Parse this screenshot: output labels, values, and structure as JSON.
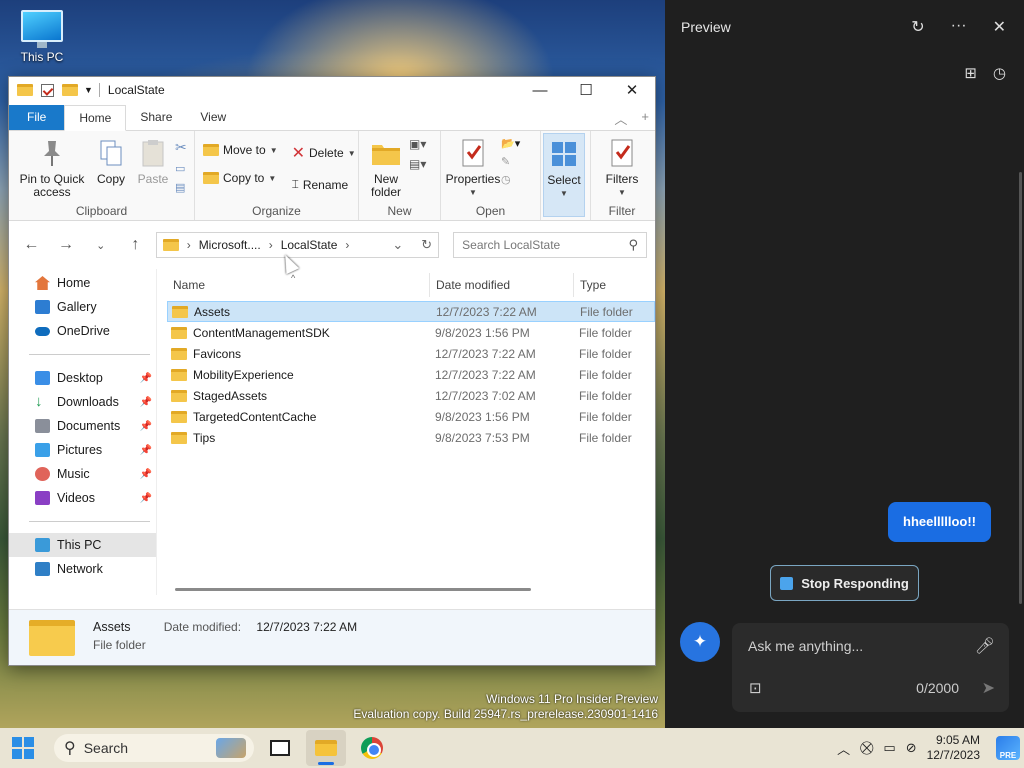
{
  "desktop": {
    "this_pc_label": "This PC",
    "watermark_line1": "Windows 11 Pro Insider Preview",
    "watermark_line2": "Evaluation copy. Build 25947.rs_prerelease.230901-1416"
  },
  "explorer": {
    "title": "LocalState",
    "tabs": {
      "file": "File",
      "home": "Home",
      "share": "Share",
      "view": "View"
    },
    "ribbon": {
      "clipboard": {
        "label": "Clipboard",
        "pin": "Pin to Quick access",
        "copy": "Copy",
        "paste": "Paste"
      },
      "organize": {
        "label": "Organize",
        "move_to": "Move to",
        "copy_to": "Copy to",
        "delete": "Delete",
        "rename": "Rename"
      },
      "new": {
        "label": "New",
        "new_folder": "New folder"
      },
      "open": {
        "label": "Open",
        "properties": "Properties"
      },
      "select": {
        "label": "Select"
      },
      "filter": {
        "label": "Filter",
        "filters": "Filters"
      }
    },
    "address": {
      "crumb1": "Microsoft....",
      "crumb2": "LocalState"
    },
    "search": {
      "placeholder": "Search LocalState"
    },
    "nav": {
      "home": "Home",
      "gallery": "Gallery",
      "onedrive": "OneDrive",
      "desktop": "Desktop",
      "downloads": "Downloads",
      "documents": "Documents",
      "pictures": "Pictures",
      "music": "Music",
      "videos": "Videos",
      "this_pc": "This PC",
      "network": "Network"
    },
    "columns": {
      "name": "Name",
      "date": "Date modified",
      "type": "Type"
    },
    "files": [
      {
        "name": "Assets",
        "date": "12/7/2023 7:22 AM",
        "type": "File folder"
      },
      {
        "name": "ContentManagementSDK",
        "date": "9/8/2023 1:56 PM",
        "type": "File folder"
      },
      {
        "name": "Favicons",
        "date": "12/7/2023 7:22 AM",
        "type": "File folder"
      },
      {
        "name": "MobilityExperience",
        "date": "12/7/2023 7:22 AM",
        "type": "File folder"
      },
      {
        "name": "StagedAssets",
        "date": "12/7/2023 7:02 AM",
        "type": "File folder"
      },
      {
        "name": "TargetedContentCache",
        "date": "9/8/2023 1:56 PM",
        "type": "File folder"
      },
      {
        "name": "Tips",
        "date": "9/8/2023 7:53 PM",
        "type": "File folder"
      }
    ],
    "details": {
      "name": "Assets",
      "type": "File folder",
      "modified_label": "Date modified:",
      "modified_value": "12/7/2023 7:22 AM"
    }
  },
  "copilot": {
    "title": "Preview",
    "user_message": "hheellllloo!!",
    "stop_label": "Stop Responding",
    "input_placeholder": "Ask me anything...",
    "char_counter": "0/2000"
  },
  "taskbar": {
    "search_label": "Search",
    "time": "9:05 AM",
    "date": "12/7/2023",
    "badge": "PRE"
  },
  "colors": {
    "accent": "#1a6de3",
    "file_tab": "#1979ca",
    "selection": "#cce4f7",
    "copilot_bg": "#1f1f1f"
  }
}
